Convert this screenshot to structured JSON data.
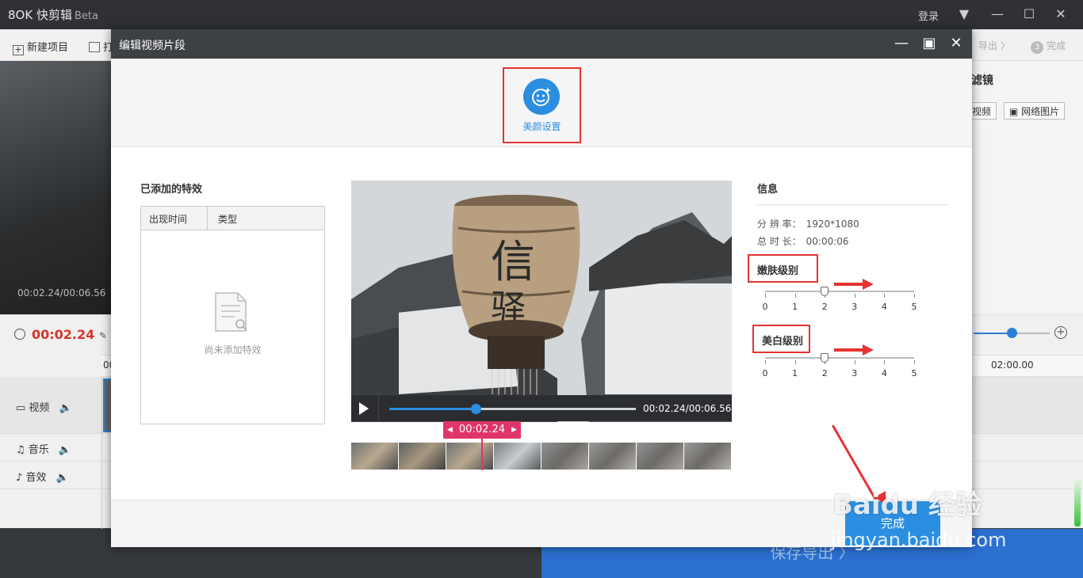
{
  "app": {
    "logo": "8OK 快剪辑",
    "beta": "Beta",
    "login": "登录",
    "toolbar": {
      "new_project": "新建项目",
      "open": "打"
    },
    "steps": {
      "export": "导出",
      "done_num": "3",
      "done": "完成"
    },
    "preview_time": "00:02.24/00:06.56",
    "right_panel": {
      "title": "滤镜",
      "video_btn": "视频",
      "net_img_btn": "网络图片"
    },
    "timeline": {
      "current_time": "00:02.24",
      "ruler_start": "00",
      "ruler_end": "02:00.00",
      "tracks": [
        {
          "label": "视频"
        },
        {
          "label": "音乐"
        },
        {
          "label": "音效"
        }
      ]
    },
    "save_export": "保存导出 〉"
  },
  "modal": {
    "title": "编辑视频片段",
    "beauty_label": "美颜设置",
    "fx_title": "已添加的特效",
    "fx_columns": [
      "出现时间",
      "类型"
    ],
    "fx_empty": "尚未添加特效",
    "player_time": "00:02.24/00:06.56",
    "progress": 0.35,
    "marker_time": "00:02.24",
    "info_title": "信息",
    "resolution_label": "分 辨 率：",
    "resolution": "1920*1080",
    "duration_label": "总 时 长：",
    "duration": "00:00:06",
    "smooth_label": "嫩肤级别",
    "smooth_level": 2,
    "whiten_label": "美白级别",
    "whiten_level": 2,
    "scale": [
      "0",
      "1",
      "2",
      "3",
      "4",
      "5"
    ],
    "done": "完成"
  },
  "watermark": {
    "main": "Baidu 经验",
    "sub": "jingyan.baidu.com"
  },
  "colors": {
    "accent": "#2b8ee0",
    "highlight": "#e53333",
    "marker": "#e0356a"
  }
}
